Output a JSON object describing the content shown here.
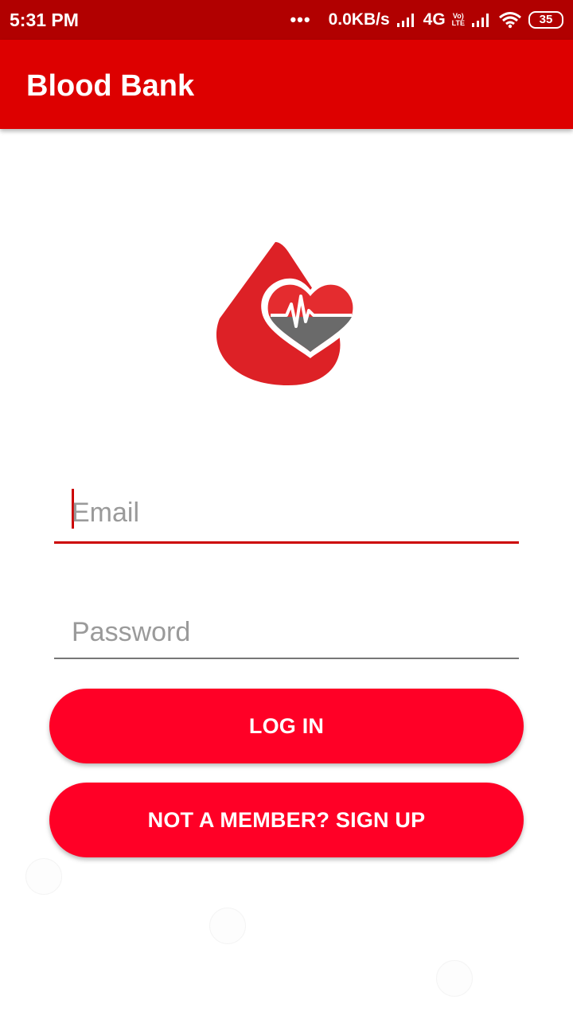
{
  "status_bar": {
    "time": "5:31 PM",
    "more_indicator": "•••",
    "network_speed": "0.0KB/s",
    "network_type": "4G",
    "volte_top": "Vo)",
    "volte_bottom": "LTE",
    "battery_level": "35",
    "icons": [
      "signal-icon",
      "signal-icon",
      "wifi-icon",
      "battery-icon"
    ]
  },
  "app_bar": {
    "title": "Blood Bank"
  },
  "logo": {
    "icon": "blood-drop-heart-logo",
    "colors": {
      "drop": "#dd2126",
      "heart_top": "#e42c2f",
      "heart_bottom": "#6a6a6a"
    }
  },
  "form": {
    "email": {
      "value": "",
      "placeholder": "Email"
    },
    "password": {
      "value": "",
      "placeholder": "Password"
    }
  },
  "buttons": {
    "login_label": "LOG IN",
    "signup_label": "NOT A MEMBER? SIGN UP"
  },
  "colors": {
    "status_bar": "#b10000",
    "app_bar": "#dd0000",
    "accent": "#cc0000",
    "button": "#ff0026"
  }
}
